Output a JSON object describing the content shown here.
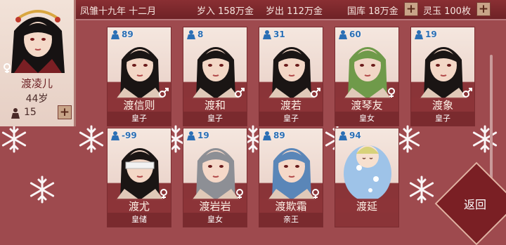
{
  "header": {
    "date": "凤雏十九年 十二月",
    "income": "岁入 158万金",
    "expense": "岁出 112万金",
    "treasury": "国库 18万金",
    "jade": "灵玉 100枚",
    "plus_label": "+"
  },
  "player": {
    "name": "渡凌儿",
    "age": "44岁",
    "count": "15",
    "gender": "female",
    "plus_label": "+"
  },
  "cards": [
    {
      "name": "渡信则",
      "title": "皇子",
      "value": "89",
      "gender": "male",
      "hair": "#1a1514",
      "skin": "#f3d7c6"
    },
    {
      "name": "渡和",
      "title": "皇子",
      "value": "8",
      "gender": "male",
      "hair": "#1a1514",
      "skin": "#f3d7c6"
    },
    {
      "name": "渡若",
      "title": "皇子",
      "value": "31",
      "gender": "male",
      "hair": "#1a1514",
      "skin": "#f3d7c6"
    },
    {
      "name": "渡琴友",
      "title": "皇女",
      "value": "60",
      "gender": "female",
      "hair": "#6f9a4a",
      "skin": "#f1d6c6"
    },
    {
      "name": "渡象",
      "title": "皇子",
      "value": "19",
      "gender": "male",
      "hair": "#1a1514",
      "skin": "#f3d7c6"
    },
    {
      "name": "渡尤",
      "title": "皇储",
      "value": "-99",
      "gender": "female",
      "hair": "#1a1514",
      "skin": "#f3d7c6"
    },
    {
      "name": "渡岩岩",
      "title": "皇女",
      "value": "19",
      "gender": "female",
      "hair": "#8d8f95",
      "skin": "#f5d8c8"
    },
    {
      "name": "渡欺霜",
      "title": "亲王",
      "value": "89",
      "gender": "female",
      "hair": "#5a86b8",
      "skin": "#f5d8c8"
    },
    {
      "name": "渡延",
      "title": "",
      "value": "94",
      "gender": "",
      "hair": "#d8d27a",
      "skin": "#f7e0cf"
    }
  ],
  "back_button": "返回",
  "colors": {
    "accent": "#7a1f24",
    "badge_blue": "#2b6fb5",
    "male_blue": "#3a78c4",
    "female_gray": "#ffffff"
  }
}
